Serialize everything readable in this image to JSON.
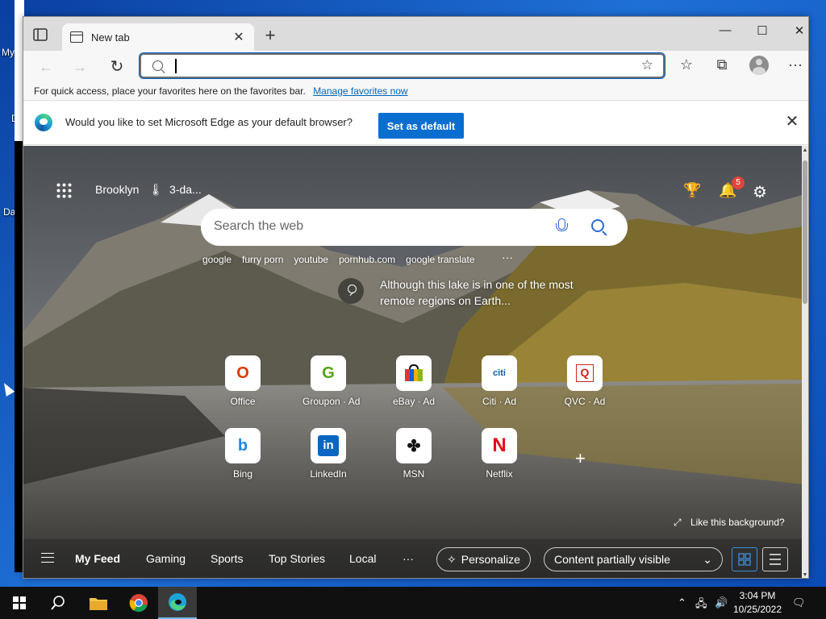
{
  "desktop": {
    "labels": [
      "My",
      "D",
      "Da"
    ]
  },
  "browser": {
    "tab": {
      "title": "New tab",
      "close": "✕"
    },
    "new_tab": "+",
    "window": {
      "minimize": "—",
      "maximize": "☐",
      "close": "✕"
    },
    "nav": {
      "back": "←",
      "forward": "→",
      "refresh": "↻"
    },
    "address": {
      "value": "",
      "placeholder": ""
    },
    "toolbar": {
      "favorites": "☆",
      "collections": "⧉",
      "more": "···"
    },
    "favorites_bar": {
      "text": "For quick access, place your favorites here on the favorites bar.",
      "link": "Manage favorites now"
    },
    "infobar": {
      "text": "Would you like to set Microsoft Edge as your default browser?",
      "button": "Set as default",
      "close": "✕"
    }
  },
  "ntp": {
    "location": "Brooklyn",
    "weather": "3-da...",
    "notification_count": "5",
    "search_placeholder": "Search the web",
    "quick_searches": [
      "google",
      "furry porn",
      "youtube",
      "pornhub.com",
      "google translate"
    ],
    "more": "···",
    "image_info": "Although this lake is in one of the most remote regions on Earth...",
    "tiles": [
      {
        "label": "Office",
        "glyph": "O",
        "color": "#d83b01"
      },
      {
        "label": "Groupon · Ad",
        "glyph": "G",
        "color": "#53a318"
      },
      {
        "label": "eBay · Ad",
        "glyph": "▟",
        "color": "#e53238"
      },
      {
        "label": "Citi · Ad",
        "glyph": "citi",
        "color": "#0f5aa8"
      },
      {
        "label": "QVC · Ad",
        "glyph": "Q",
        "color": "#c22"
      },
      {
        "label": "Bing",
        "glyph": "b",
        "color": "#1e88e5"
      },
      {
        "label": "LinkedIn",
        "glyph": "in",
        "color": "#0a66c2"
      },
      {
        "label": "MSN",
        "glyph": "✤",
        "color": "#111"
      },
      {
        "label": "Netflix",
        "glyph": "N",
        "color": "#e50914"
      }
    ],
    "add_tile": "+",
    "like_background": "Like this background?",
    "feed": {
      "items": [
        "My Feed",
        "Gaming",
        "Sports",
        "Top Stories",
        "Local"
      ],
      "more": "···",
      "personalize": "Personalize",
      "content_visibility": "Content partially visible"
    }
  },
  "taskbar": {
    "time": "3:04 PM",
    "date": "10/25/2022"
  }
}
